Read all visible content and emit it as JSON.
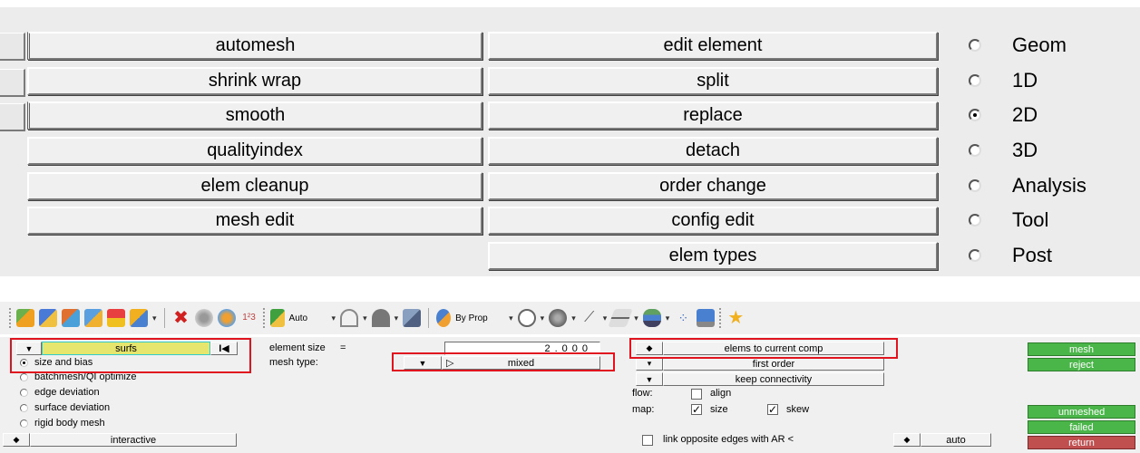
{
  "top_panel": {
    "left_buttons": [
      "automesh",
      "shrink wrap",
      "smooth",
      "qualityindex",
      "elem cleanup",
      "mesh edit"
    ],
    "right_buttons": [
      "edit element",
      "split",
      "replace",
      "detach",
      "order change",
      "config edit",
      "elem types"
    ],
    "radios": [
      {
        "label": "Geom",
        "selected": false
      },
      {
        "label": "1D",
        "selected": false
      },
      {
        "label": "2D",
        "selected": true
      },
      {
        "label": "3D",
        "selected": false
      },
      {
        "label": "Analysis",
        "selected": false
      },
      {
        "label": "Tool",
        "selected": false
      },
      {
        "label": "Post",
        "selected": false
      }
    ]
  },
  "toolbar": {
    "display_mode": "Auto",
    "color_mode": "By Prop",
    "icons": [
      "component-icon",
      "surface-icon",
      "edit-icon",
      "element-icon",
      "shrink-icon",
      "translate-icon",
      "delete-icon",
      "mask-icon",
      "unmask-icon",
      "numbers-icon",
      "display-mode-icon",
      "geometry-view-icon",
      "surface-view-icon",
      "solid-view-icon",
      "color-by-prop-icon",
      "mesh-view-icon",
      "shaded-view-icon",
      "line-view-icon",
      "plane-view-icon",
      "layer-icon",
      "node-icon",
      "monitor-icon",
      "favorites-star-icon"
    ]
  },
  "bottom_panel": {
    "entity_selector": "surfs",
    "options": [
      {
        "label": "size and bias",
        "selected": true
      },
      {
        "label": "batchmesh/QI optimize",
        "selected": false
      },
      {
        "label": "edge deviation",
        "selected": false
      },
      {
        "label": "surface deviation",
        "selected": false
      },
      {
        "label": "rigid body mesh",
        "selected": false
      }
    ],
    "mode": "interactive",
    "element_size_label": "element size",
    "element_size_eq": "=",
    "element_size_value": "2.000",
    "mesh_type_label": "mesh type:",
    "mesh_type_value": "mixed",
    "elems_to_current_comp": "elems to current comp",
    "first_order": "first order",
    "keep_connectivity": "keep connectivity",
    "flow_label": "flow:",
    "align_label": "align",
    "map_label": "map:",
    "size_label": "size",
    "skew_label": "skew",
    "link_edges_label": "link opposite edges with AR <",
    "auto_label": "auto",
    "mesh_btn": "mesh",
    "reject_btn": "reject",
    "unmeshed_btn": "unmeshed",
    "failed_btn": "failed",
    "return_btn": "return"
  },
  "colors": {
    "green": "#4ab64a",
    "return_red": "#c05050",
    "highlight_yellow": "#e6e66e",
    "annotation_red": "#e0141e"
  }
}
